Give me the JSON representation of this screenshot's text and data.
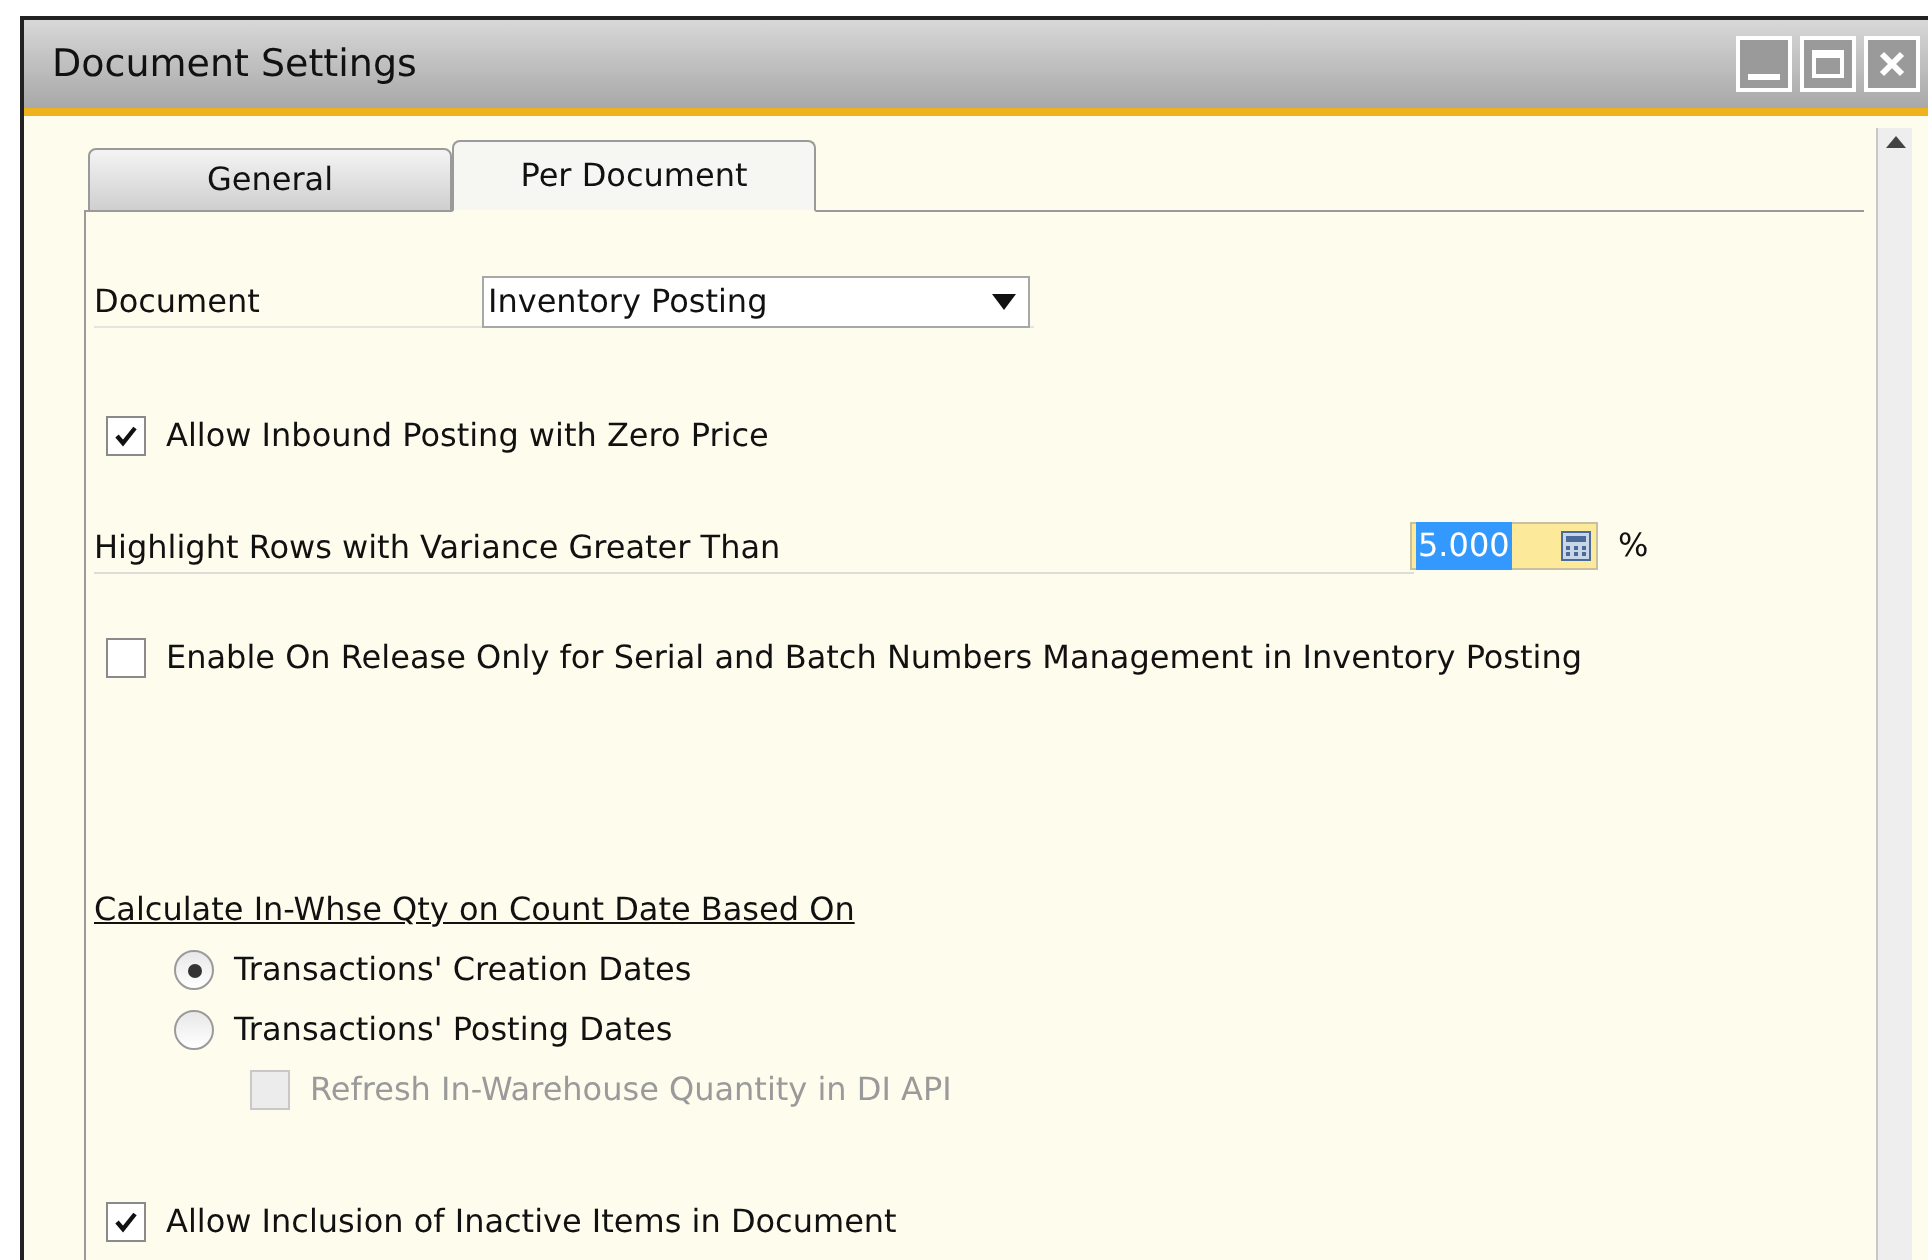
{
  "window": {
    "title": "Document Settings"
  },
  "tabs": [
    {
      "label": "General",
      "selected": false
    },
    {
      "label": "Per Document",
      "selected": true
    }
  ],
  "document": {
    "label": "Document",
    "value": "Inventory Posting"
  },
  "allow_inbound": {
    "label": "Allow Inbound Posting with Zero Price",
    "checked": true
  },
  "highlight": {
    "label": "Highlight Rows with Variance Greater Than",
    "value": "5.000",
    "unit": "%",
    "focused": true
  },
  "enable_on_release": {
    "label": "Enable On Release Only for Serial and Batch Numbers Management in Inventory Posting",
    "checked": false
  },
  "calculate": {
    "title": "Calculate In-Whse Qty on Count Date Based On",
    "options": [
      {
        "label": "Transactions' Creation Dates",
        "selected": true
      },
      {
        "label": "Transactions' Posting Dates",
        "selected": false
      }
    ],
    "refresh": {
      "label": "Refresh In-Warehouse Quantity in DI API",
      "checked": false,
      "disabled": true
    }
  },
  "allow_inactive": {
    "label": "Allow Inclusion of Inactive Items in Document",
    "checked": true
  }
}
